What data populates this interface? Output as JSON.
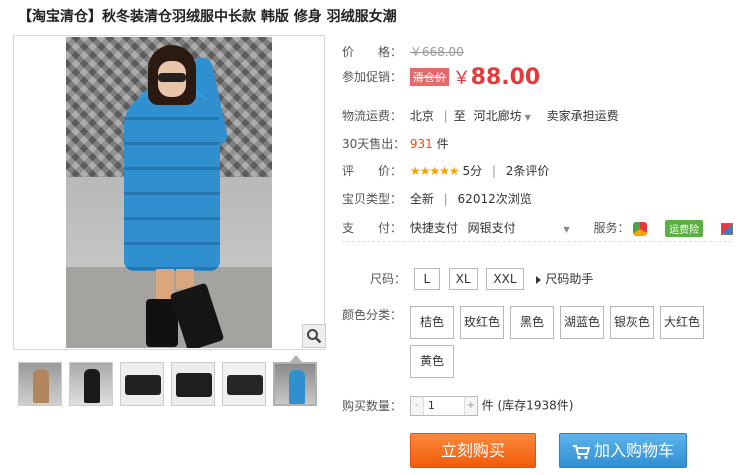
{
  "title": "【淘宝清仓】秋冬装清仓羽绒服中长款 韩版 修身 羽绒服女潮",
  "price": {
    "label": "价　　格：",
    "original": "￥668.00"
  },
  "promo": {
    "label": "参加促销：",
    "tag": "清仓价",
    "currency": "￥",
    "amount": "88.00"
  },
  "shipping": {
    "label": "物流运费：",
    "from": "北京",
    "to_prefix": "至",
    "to": "河北廊坊",
    "fee": "卖家承担运费"
  },
  "sales": {
    "label": "30天售出：",
    "count": "931",
    "unit": "件"
  },
  "rating": {
    "label": "评　　价：",
    "stars": "★★★★★",
    "score": "5分",
    "reviews": "2条评价"
  },
  "type": {
    "label": "宝贝类型：",
    "value": "全新",
    "views": "62012次浏览"
  },
  "payment": {
    "label": "支　　付：",
    "methods": [
      "快捷支付",
      "网银支付"
    ],
    "service_label": "服务：",
    "insurance": "运费险"
  },
  "size": {
    "label": "尺码：",
    "options": [
      "L",
      "XL",
      "XXL"
    ],
    "helper": "尺码助手"
  },
  "colors": {
    "label": "颜色分类：",
    "options": [
      "桔色",
      "玫红色",
      "黑色",
      "湖蓝色",
      "银灰色",
      "大红色",
      "黄色"
    ]
  },
  "quantity": {
    "label": "购买数量：",
    "minus": "-",
    "value": "1",
    "plus": "+",
    "unit": "件",
    "stock": "(库存1938件)"
  },
  "actions": {
    "buy_now": "立刻购买",
    "add_to_cart": "加入购物车"
  },
  "icons": [
    "magnifier-icon",
    "dropdown-caret-icon",
    "shield-icon",
    "cart-icon",
    "box-icon"
  ],
  "colors_theme": {
    "price_red": "#e4393c",
    "buy_orange": "#f25b0a",
    "cart_blue": "#2f8fd3",
    "coat_blue": "#2f8fcf"
  }
}
